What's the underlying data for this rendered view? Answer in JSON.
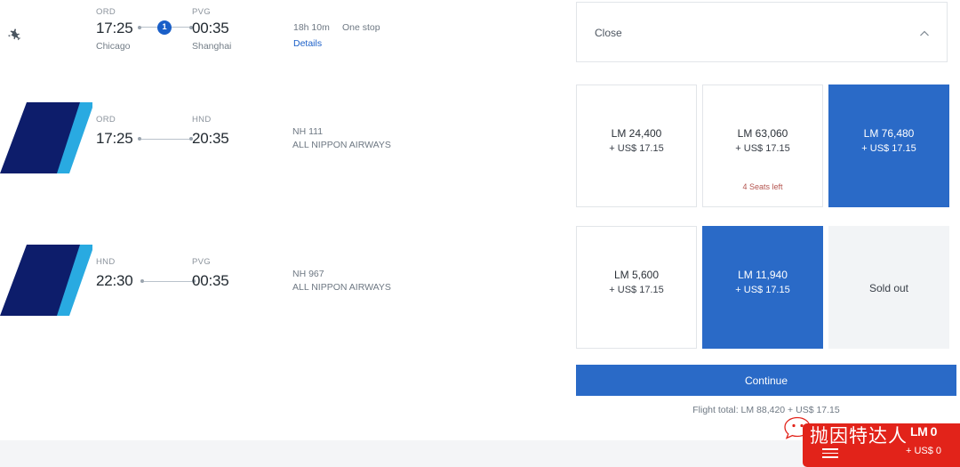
{
  "itinerary": {
    "plane_icon": "departing-plane-icon",
    "origin": {
      "code": "ORD",
      "time": "17:25",
      "city": "Chicago"
    },
    "destination": {
      "code": "PVG",
      "time": "00:35",
      "city": "Shanghai"
    },
    "stop_count": "1",
    "duration": "18h 10m",
    "stops_label": "One stop",
    "details_label": "Details"
  },
  "segments": [
    {
      "origin_code": "ORD",
      "origin_time": "17:25",
      "dest_code": "HND",
      "dest_time": "20:35",
      "flight_number": "NH 111",
      "airline": "ALL NIPPON AIRWAYS"
    },
    {
      "origin_code": "HND",
      "origin_time": "22:30",
      "dest_code": "PVG",
      "dest_time": "00:35",
      "flight_number": "NH 967",
      "airline": "ALL NIPPON AIRWAYS"
    }
  ],
  "panel": {
    "close_label": "Close",
    "collapse_icon": "chevron-up-icon"
  },
  "fare_rows": [
    {
      "cards": [
        {
          "state": "plain",
          "main": "LM 24,400",
          "sub": "+ US$ 17.15",
          "note": ""
        },
        {
          "state": "plain",
          "main": "LM 63,060",
          "sub": "+ US$ 17.15",
          "note": "4 Seats left"
        },
        {
          "state": "selected",
          "main": "LM 76,480",
          "sub": "+ US$ 17.15",
          "note": ""
        }
      ]
    },
    {
      "cards": [
        {
          "state": "plain",
          "main": "LM 5,600",
          "sub": "+ US$ 17.15",
          "note": ""
        },
        {
          "state": "selected",
          "main": "LM 11,940",
          "sub": "+ US$ 17.15",
          "note": ""
        },
        {
          "state": "soldout",
          "main": "Sold out",
          "sub": "",
          "note": ""
        }
      ]
    }
  ],
  "actions": {
    "continue_label": "Continue",
    "flight_total": "Flight total: LM 88,420 + US$ 17.15"
  },
  "watermark": {
    "text": "抛因特达人",
    "menu_icon": "hamburger-icon",
    "bubble_icon": "speech-bubble-face-icon",
    "lm_amount": "LM 0",
    "usd_amount": "+ US$ 0",
    "color": "#e2231a"
  },
  "colors": {
    "accent_blue": "#2a6ac7",
    "badge_blue": "#1a5fc8",
    "ana_navy": "#0d1d6b",
    "ana_cyan": "#29aae1",
    "seats_red": "#b4544f",
    "footer_gray": "#f4f5f7"
  }
}
